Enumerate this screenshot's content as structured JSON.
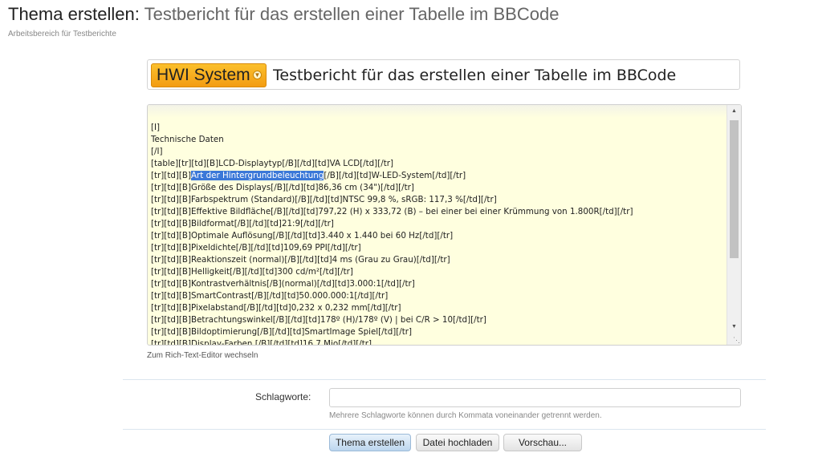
{
  "header": {
    "title_prefix": "Thema erstellen:",
    "title_subject": "Testbericht für das erstellen einer Tabelle im BBCode",
    "breadcrumb": "Arbeitsbereich für Testberichte"
  },
  "title_field": {
    "prefix_label": "HWI System",
    "value": "Testbericht für das erstellen einer Tabelle im BBCode"
  },
  "editor": {
    "lines": [
      "[I]",
      "Technische Daten",
      "[/I]",
      "[table][tr][td][B]LCD-Displaytyp[/B][/td][td]VA LCD[/td][/tr]",
      "[tr][td][B]Art der Hintergrundbeleuchtung[/B][/td][td]W-LED-System[/td][/tr]",
      "[tr][td][B]Größe des Displays[/B][/td][td]86,36 cm (34\")[/td][/tr]",
      "[tr][td][B]Farbspektrum (Standard)[/B][/td][td]NTSC 99,8 %, sRGB: 117,3 %[/td][/tr]",
      "[tr][td][B]Effektive Bildfläche[/B][/td][td]797,22 (H) x 333,72 (B) – bei einer bei einer Krümmung von 1.800R[/td][/tr]",
      "[tr][td][B]Bildformat[/B][/td][td]21:9[/td][/tr]",
      "[tr][td][B]Optimale Auflösung[/B][/td][td]3.440 x 1.440 bei 60 Hz[/td][/tr]",
      "[tr][td][B]Pixeldichte[/B][/td][td]109,69 PPI[/td][/tr]",
      "[tr][td][B]Reaktionszeit (normal)[/B][/td][td]4 ms (Grau zu Grau)[/td][/tr]",
      "[tr][td][B]Helligkeit[/B][/td][td]300 cd/m²[/td][/tr]",
      "[tr][td][B]Kontrastverhältnis[/B](normal)[/td][td]3.000:1[/td][/tr]",
      "[tr][td][B]SmartContrast[/B][/td][td]50.000.000:1[/td][/tr]",
      "[tr][td][B]Pixelabstand[/B][/td][td]0,232 x 0,232 mm[/td][/tr]",
      "[tr][td][B]Betrachtungswinkel[/B][/td][td]178º (H)/178º (V) | bei C/R > 10[/td][/tr]",
      "[tr][td][B]Bildoptimierung[/B][/td][td]SmartImage Spiel[/td][/tr]",
      "[tr][td][B]Display-Farben [/B][/td][td]16,7 Mio[/td][/tr]"
    ],
    "selected_line": {
      "before": "[tr][td][B]",
      "selected": "Art der Hintergrundbeleuchtung",
      "after": "[/B][/td][td]W-LED-System[/td][/tr]"
    },
    "switch_link": "Zum Rich-Text-Editor wechseln"
  },
  "tags": {
    "label": "Schlagworte:",
    "value": "",
    "hint": "Mehrere Schlagworte können durch Kommata voneinander getrennt werden."
  },
  "buttons": {
    "create": "Thema erstellen",
    "upload": "Datei hochladen",
    "preview": "Vorschau..."
  },
  "colors": {
    "editor_bg": "#ffffdf",
    "prefix_bg": "#f5a623",
    "selection": "#3b78d8"
  },
  "icons": {
    "prefix_dropdown": "chevron-down-icon",
    "scroll_up": "arrow-up-icon",
    "scroll_down": "arrow-down-icon",
    "resize": "resize-grip-icon"
  }
}
